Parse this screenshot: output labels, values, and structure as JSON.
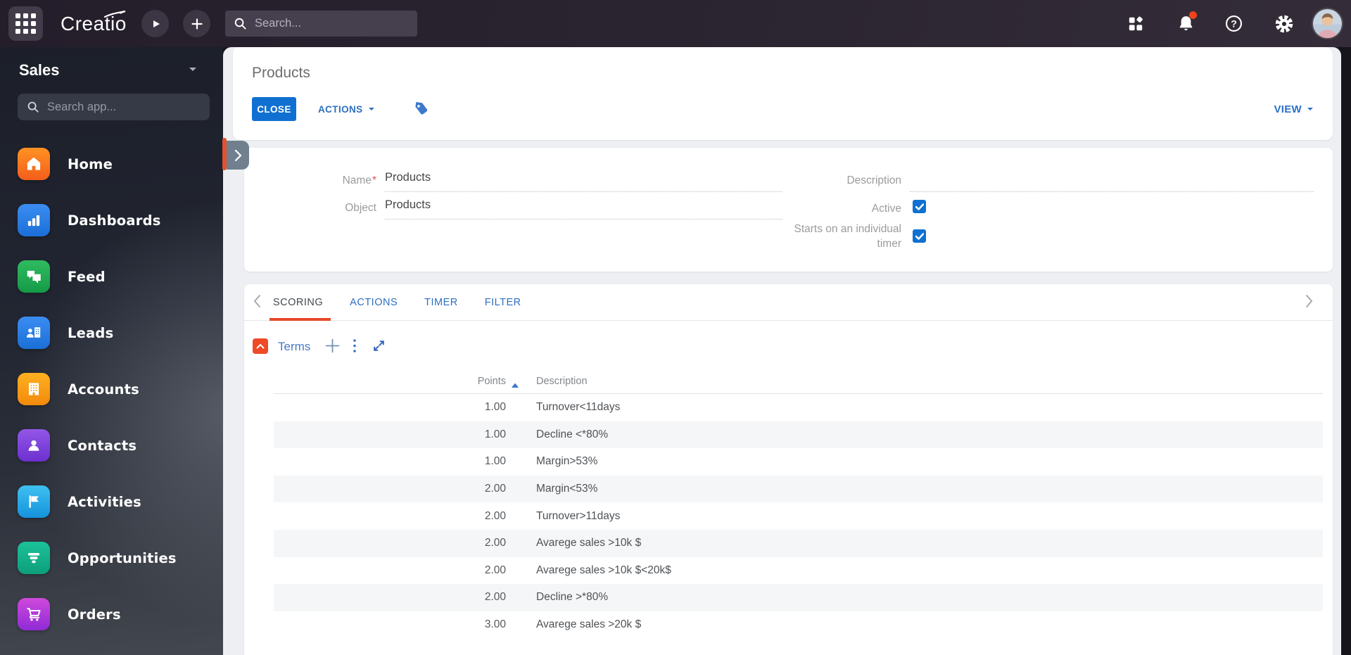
{
  "topbar": {
    "logo": "Creatio",
    "search_placeholder": "Search...",
    "icons": [
      "apps-grid",
      "play",
      "add",
      "search",
      "workspaces",
      "notifications",
      "help",
      "settings",
      "user-avatar"
    ],
    "notification_dot_color": "#f2421b"
  },
  "sidebar": {
    "workspace": "Sales",
    "search_placeholder": "Search app...",
    "items": [
      {
        "label": "Home",
        "icon": "home",
        "color_from": "#ff9222",
        "color_to": "#f45e1c"
      },
      {
        "label": "Dashboards",
        "icon": "dashboards",
        "color_from": "#3b8df2",
        "color_to": "#1a6fd6"
      },
      {
        "label": "Feed",
        "icon": "feed",
        "color_from": "#2fbb5f",
        "color_to": "#149a47"
      },
      {
        "label": "Leads",
        "icon": "leads",
        "color_from": "#3b8df2",
        "color_to": "#1a6fd6"
      },
      {
        "label": "Accounts",
        "icon": "accounts",
        "color_from": "#ffb020",
        "color_to": "#f28a0c"
      },
      {
        "label": "Contacts",
        "icon": "contacts",
        "color_from": "#9257e8",
        "color_to": "#6d30cf"
      },
      {
        "label": "Activities",
        "icon": "activities",
        "color_from": "#3ec1f0",
        "color_to": "#1693dd"
      },
      {
        "label": "Opportunities",
        "icon": "opportunities",
        "color_from": "#1cc29a",
        "color_to": "#0d9e7b"
      },
      {
        "label": "Orders",
        "icon": "orders",
        "color_from": "#cf49dc",
        "color_to": "#8f2bd6"
      }
    ]
  },
  "page": {
    "title": "Products",
    "close": "CLOSE",
    "actions": "ACTIONS",
    "view": "VIEW"
  },
  "form": {
    "name_label": "Name",
    "name_required": "*",
    "name_value": "Products",
    "object_label": "Object",
    "object_value": "Products",
    "description_label": "Description",
    "description_value": "",
    "active_label": "Active",
    "active_checked": true,
    "timer_label": "Starts on an individual timer",
    "timer_checked": true
  },
  "tabs": {
    "items": [
      {
        "label": "SCORING",
        "active": true
      },
      {
        "label": "ACTIONS"
      },
      {
        "label": "TIMER"
      },
      {
        "label": "FILTER"
      }
    ]
  },
  "section": {
    "title": "Terms"
  },
  "table": {
    "columns": [
      {
        "label": "Points",
        "sort": "asc"
      },
      {
        "label": "Description"
      }
    ],
    "rows": [
      {
        "points": "1.00",
        "description": "Turnover<11days"
      },
      {
        "points": "1.00",
        "description": "Decline <*80%"
      },
      {
        "points": "1.00",
        "description": "Margin>53%"
      },
      {
        "points": "2.00",
        "description": "Margin<53%"
      },
      {
        "points": "2.00",
        "description": "Turnover>11days"
      },
      {
        "points": "2.00",
        "description": "Avarege sales >10k $"
      },
      {
        "points": "2.00",
        "description": "Avarege sales >10k $<20k$"
      },
      {
        "points": "2.00",
        "description": "Decline >*80%"
      },
      {
        "points": "3.00",
        "description": "Avarege sales >20k $"
      }
    ]
  },
  "colors": {
    "primary_blue": "#1070d2",
    "accent_orange": "#ee4a27",
    "link_blue": "#2e6fc0",
    "tab_underline": "#e8482a",
    "row_alt": "#f5f6f7"
  }
}
